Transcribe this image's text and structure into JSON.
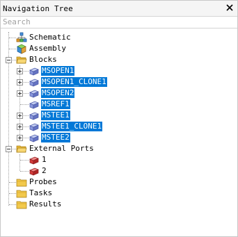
{
  "panel": {
    "title": "Navigation Tree",
    "close_glyph": "✕"
  },
  "search": {
    "placeholder": "Search",
    "value": ""
  },
  "tree": {
    "schematic": {
      "label": "Schematic",
      "icon": "schematic-icon"
    },
    "assembly": {
      "label": "Assembly",
      "icon": "assembly-icon"
    },
    "blocks": {
      "label": "Blocks",
      "icon": "folder-open-icon",
      "children": [
        {
          "label": "MSOPEN1",
          "selected": true,
          "expandable": true
        },
        {
          "label": "MSOPEN1_CLONE1",
          "selected": true,
          "expandable": true
        },
        {
          "label": "MSOPEN2",
          "selected": true,
          "expandable": true
        },
        {
          "label": "MSREF1",
          "selected": true,
          "expandable": false
        },
        {
          "label": "MSTEE1",
          "selected": true,
          "expandable": true
        },
        {
          "label": "MSTEE1_CLONE1",
          "selected": true,
          "expandable": true
        },
        {
          "label": "MSTEE2",
          "selected": true,
          "expandable": true
        }
      ]
    },
    "external_ports": {
      "label": "External Ports",
      "icon": "folder-open-icon",
      "children": [
        {
          "label": "1"
        },
        {
          "label": "2"
        }
      ]
    },
    "probes": {
      "label": "Probes",
      "icon": "folder-icon"
    },
    "tasks": {
      "label": "Tasks",
      "icon": "folder-icon"
    },
    "results": {
      "label": "Results",
      "icon": "folder-icon"
    }
  },
  "colors": {
    "selection": "#0078d7",
    "folder": "#f2c94c",
    "block": "#7f8fd6",
    "port": "#d33a3a"
  }
}
